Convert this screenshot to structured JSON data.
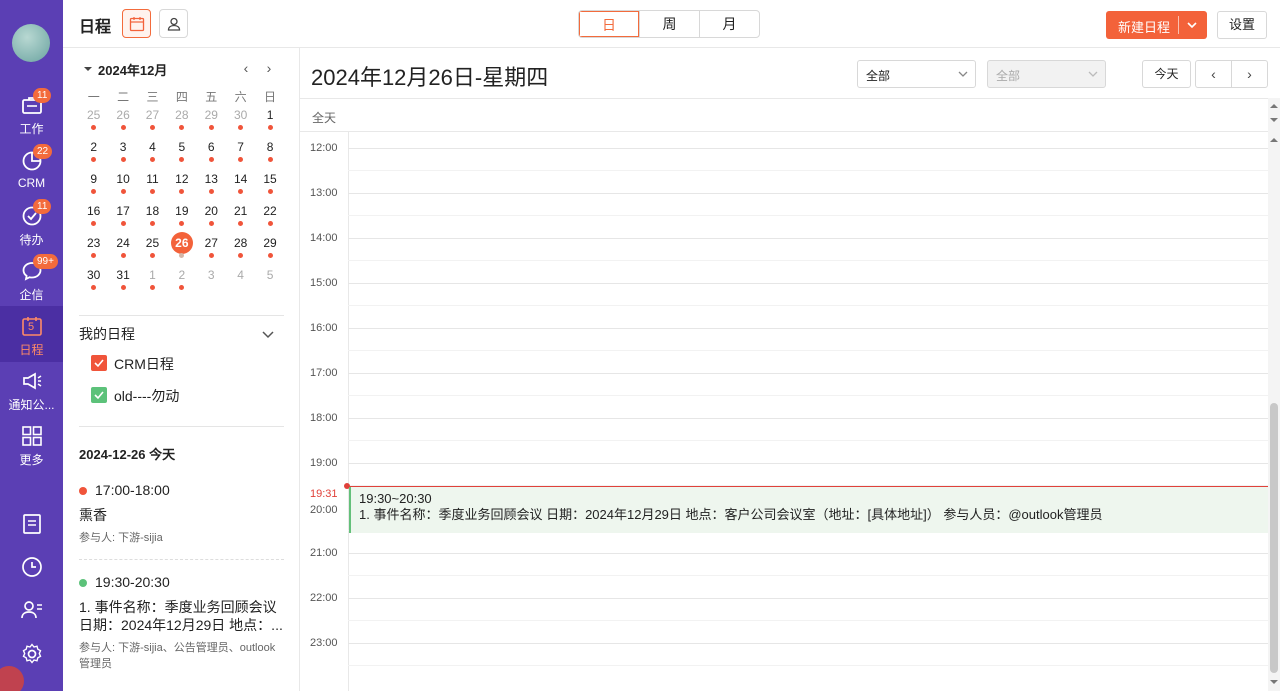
{
  "nav": {
    "items": [
      {
        "label": "工作",
        "badge": "11"
      },
      {
        "label": "CRM",
        "badge": "22"
      },
      {
        "label": "待办",
        "badge": "11"
      },
      {
        "label": "企信",
        "badge": "99+"
      },
      {
        "label": "日程",
        "badge": "",
        "icon_text": "5"
      },
      {
        "label": "通知公...",
        "badge": ""
      },
      {
        "label": "更多",
        "badge": ""
      }
    ]
  },
  "header": {
    "title": "日程",
    "views": [
      "日",
      "周",
      "月"
    ],
    "active_view": "日",
    "new_button": "新建日程",
    "settings_button": "设置"
  },
  "mini_calendar": {
    "month_label": "2024年12月",
    "weekdays": [
      "一",
      "二",
      "三",
      "四",
      "五",
      "六",
      "日"
    ],
    "weeks": [
      [
        {
          "d": "25",
          "o": true,
          "e": true
        },
        {
          "d": "26",
          "o": true,
          "e": true
        },
        {
          "d": "27",
          "o": true,
          "e": true
        },
        {
          "d": "28",
          "o": true,
          "e": true
        },
        {
          "d": "29",
          "o": true,
          "e": true
        },
        {
          "d": "30",
          "o": true,
          "e": true
        },
        {
          "d": "1",
          "o": false,
          "e": true
        }
      ],
      [
        {
          "d": "2",
          "o": false,
          "e": true
        },
        {
          "d": "3",
          "o": false,
          "e": true
        },
        {
          "d": "4",
          "o": false,
          "e": true
        },
        {
          "d": "5",
          "o": false,
          "e": true
        },
        {
          "d": "6",
          "o": false,
          "e": true
        },
        {
          "d": "7",
          "o": false,
          "e": true
        },
        {
          "d": "8",
          "o": false,
          "e": true
        }
      ],
      [
        {
          "d": "9",
          "o": false,
          "e": true
        },
        {
          "d": "10",
          "o": false,
          "e": true
        },
        {
          "d": "11",
          "o": false,
          "e": true
        },
        {
          "d": "12",
          "o": false,
          "e": true
        },
        {
          "d": "13",
          "o": false,
          "e": true
        },
        {
          "d": "14",
          "o": false,
          "e": true
        },
        {
          "d": "15",
          "o": false,
          "e": true
        }
      ],
      [
        {
          "d": "16",
          "o": false,
          "e": true
        },
        {
          "d": "17",
          "o": false,
          "e": true
        },
        {
          "d": "18",
          "o": false,
          "e": true
        },
        {
          "d": "19",
          "o": false,
          "e": true
        },
        {
          "d": "20",
          "o": false,
          "e": true
        },
        {
          "d": "21",
          "o": false,
          "e": true
        },
        {
          "d": "22",
          "o": false,
          "e": true
        }
      ],
      [
        {
          "d": "23",
          "o": false,
          "e": true
        },
        {
          "d": "24",
          "o": false,
          "e": true
        },
        {
          "d": "25",
          "o": false,
          "e": true
        },
        {
          "d": "26",
          "o": false,
          "e": true,
          "t": true
        },
        {
          "d": "27",
          "o": false,
          "e": true
        },
        {
          "d": "28",
          "o": false,
          "e": true
        },
        {
          "d": "29",
          "o": false,
          "e": true
        }
      ],
      [
        {
          "d": "30",
          "o": false,
          "e": true
        },
        {
          "d": "31",
          "o": false,
          "e": true
        },
        {
          "d": "1",
          "o": true,
          "e": true
        },
        {
          "d": "2",
          "o": true,
          "e": true
        },
        {
          "d": "3",
          "o": true,
          "e": false
        },
        {
          "d": "4",
          "o": true,
          "e": false
        },
        {
          "d": "5",
          "o": true,
          "e": false
        }
      ]
    ]
  },
  "my_calendars": {
    "title": "我的日程",
    "items": [
      {
        "label": "CRM日程",
        "color": "#f0543a"
      },
      {
        "label": "old----勿动",
        "color": "#5cc27a"
      }
    ]
  },
  "agenda": {
    "heading": "2024-12-26 今天",
    "events": [
      {
        "time": "17:00-18:00",
        "color": "#f0543a",
        "title": "熏香",
        "participants": "参与人: 下游-sijia"
      },
      {
        "time": "19:30-20:30",
        "color": "#5cc27a",
        "title": "1. 事件名称：季度业务回顾会议 日期：2024年12月29日 地点：...",
        "participants": "参与人: 下游-sijia、公告管理员、outlook管理员"
      }
    ]
  },
  "main": {
    "date_title": "2024年12月26日-星期四",
    "filter1": "全部",
    "filter2": "全部",
    "today_button": "今天",
    "allday_label": "全天",
    "hours": [
      "12:00",
      "13:00",
      "14:00",
      "15:00",
      "16:00",
      "17:00",
      "18:00",
      "19:00",
      "20:00",
      "21:00",
      "22:00",
      "23:00"
    ],
    "now_time": "19:31",
    "event": {
      "time": "19:30~20:30",
      "text": "1. 事件名称：季度业务回顾会议 日期：2024年12月29日 地点：客户公司会议室（地址：[具体地址]） 参与人员：@outlook管理员"
    }
  },
  "colors": {
    "rail": "#5b3fb4",
    "accent": "#f3623a",
    "event_green": "#64c07a"
  }
}
